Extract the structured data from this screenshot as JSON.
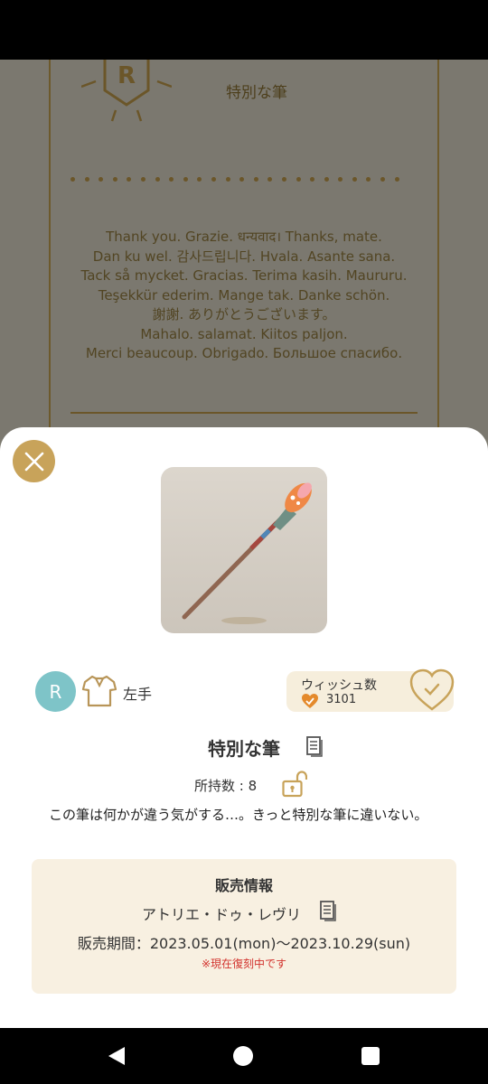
{
  "background": {
    "badge_letter": "R",
    "title": "特別な筆",
    "thanks_lines": [
      "Thank you. Grazie. धन्यवाद। Thanks, mate.",
      "Dan ku wel. 감사드립니다. Hvala. Asante sana.",
      "Tack så mycket. Gracias. Terima kasih. Maururu.",
      "Teşekkür ederim. Mange tak. Danke schön.",
      "謝謝. ありがとうございます。",
      "Mahalo. salamat. Kiitos paljon.",
      "Merci beaucoup. Obrigado. Большое спасибо."
    ]
  },
  "sheet": {
    "rarity_letter": "R",
    "hand": "左手",
    "wish": {
      "label": "ウィッシュ数",
      "count": "3101"
    },
    "item_name": "特別な筆",
    "owned_label": "所持数 : 8",
    "description": "この筆は何かが違う気がする…。きっと特別な筆に違いない。",
    "sales": {
      "title": "販売情報",
      "shop": "アトリエ・ドゥ・レヴリ",
      "period": "販売期間：2023.05.01(mon)〜2023.10.29(sun)",
      "note": "※現在復刻中です"
    }
  },
  "colors": {
    "gold": "#c8a35a",
    "teal": "#7ec4c8",
    "cream": "#f8f0e1",
    "red_note": "#d2322d"
  },
  "icons": [
    "close-icon",
    "shirt-icon",
    "heart-icon",
    "heart-check-icon",
    "copy-icon",
    "unlock-icon",
    "nav-back-icon",
    "nav-home-icon",
    "nav-recent-icon"
  ]
}
